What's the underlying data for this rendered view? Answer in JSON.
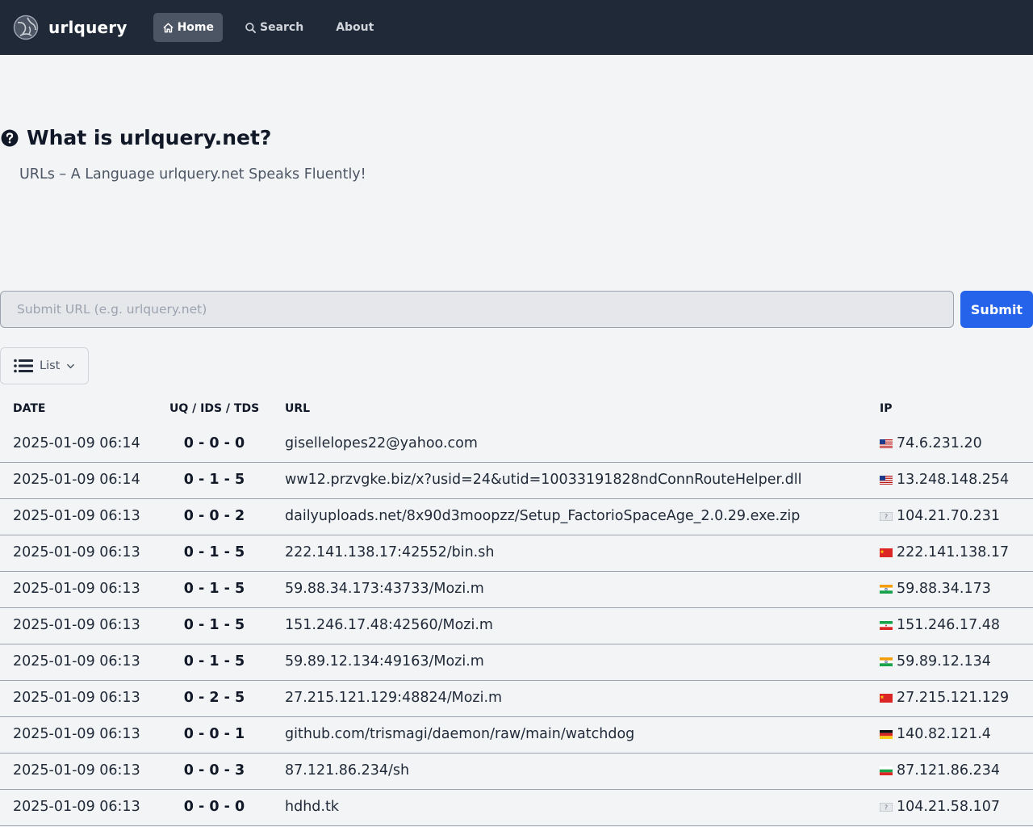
{
  "navbar": {
    "brand": "urlquery",
    "links": [
      {
        "label": "Home",
        "icon": "home-icon",
        "active": true
      },
      {
        "label": "Search",
        "icon": "search-icon",
        "active": false
      },
      {
        "label": "About",
        "active": false
      }
    ]
  },
  "hero": {
    "title": "What is urlquery.net?",
    "subtitle": "URLs – A Language urlquery.net Speaks Fluently!"
  },
  "submit": {
    "placeholder": "Submit URL (e.g. urlquery.net)",
    "value": "",
    "button_label": "Submit"
  },
  "view": {
    "label": "List",
    "icon": "list-icon"
  },
  "table": {
    "columns": [
      "DATE",
      "UQ / IDS / TDS",
      "URL",
      "IP"
    ],
    "rows": [
      {
        "date": "2025-01-09 06:14",
        "score": "0 - 0 - 0",
        "url": "gisellelopes22@yahoo.com",
        "flag": "us",
        "ip": "74.6.231.20"
      },
      {
        "date": "2025-01-09 06:14",
        "score": "0 - 1 - 5",
        "url": "ww12.przvgke.biz/x?usid=24&utid=10033191828ndConnRouteHelper.dll",
        "flag": "us",
        "ip": "13.248.148.254"
      },
      {
        "date": "2025-01-09 06:13",
        "score": "0 - 0 - 2",
        "url": "dailyuploads.net/8x90d3moopzz/Setup_FactorioSpaceAge_2.0.29.exe.zip",
        "flag": "unknown",
        "ip": "104.21.70.231"
      },
      {
        "date": "2025-01-09 06:13",
        "score": "0 - 1 - 5",
        "url": "222.141.138.17:42552/bin.sh",
        "flag": "cn",
        "ip": "222.141.138.17"
      },
      {
        "date": "2025-01-09 06:13",
        "score": "0 - 1 - 5",
        "url": "59.88.34.173:43733/Mozi.m",
        "flag": "in",
        "ip": "59.88.34.173"
      },
      {
        "date": "2025-01-09 06:13",
        "score": "0 - 1 - 5",
        "url": "151.246.17.48:42560/Mozi.m",
        "flag": "ir",
        "ip": "151.246.17.48"
      },
      {
        "date": "2025-01-09 06:13",
        "score": "0 - 1 - 5",
        "url": "59.89.12.134:49163/Mozi.m",
        "flag": "in",
        "ip": "59.89.12.134"
      },
      {
        "date": "2025-01-09 06:13",
        "score": "0 - 2 - 5",
        "url": "27.215.121.129:48824/Mozi.m",
        "flag": "cn",
        "ip": "27.215.121.129"
      },
      {
        "date": "2025-01-09 06:13",
        "score": "0 - 0 - 1",
        "url": "github.com/trismagi/daemon/raw/main/watchdog",
        "flag": "de",
        "ip": "140.82.121.4"
      },
      {
        "date": "2025-01-09 06:13",
        "score": "0 - 0 - 3",
        "url": "87.121.86.234/sh",
        "flag": "bg",
        "ip": "87.121.86.234"
      },
      {
        "date": "2025-01-09 06:13",
        "score": "0 - 0 - 0",
        "url": "hdhd.tk",
        "flag": "unknown",
        "ip": "104.21.58.107"
      }
    ]
  },
  "colors": {
    "navbar_bg": "#1f2937",
    "page_bg": "#f3f4f6",
    "accent": "#2563eb"
  }
}
